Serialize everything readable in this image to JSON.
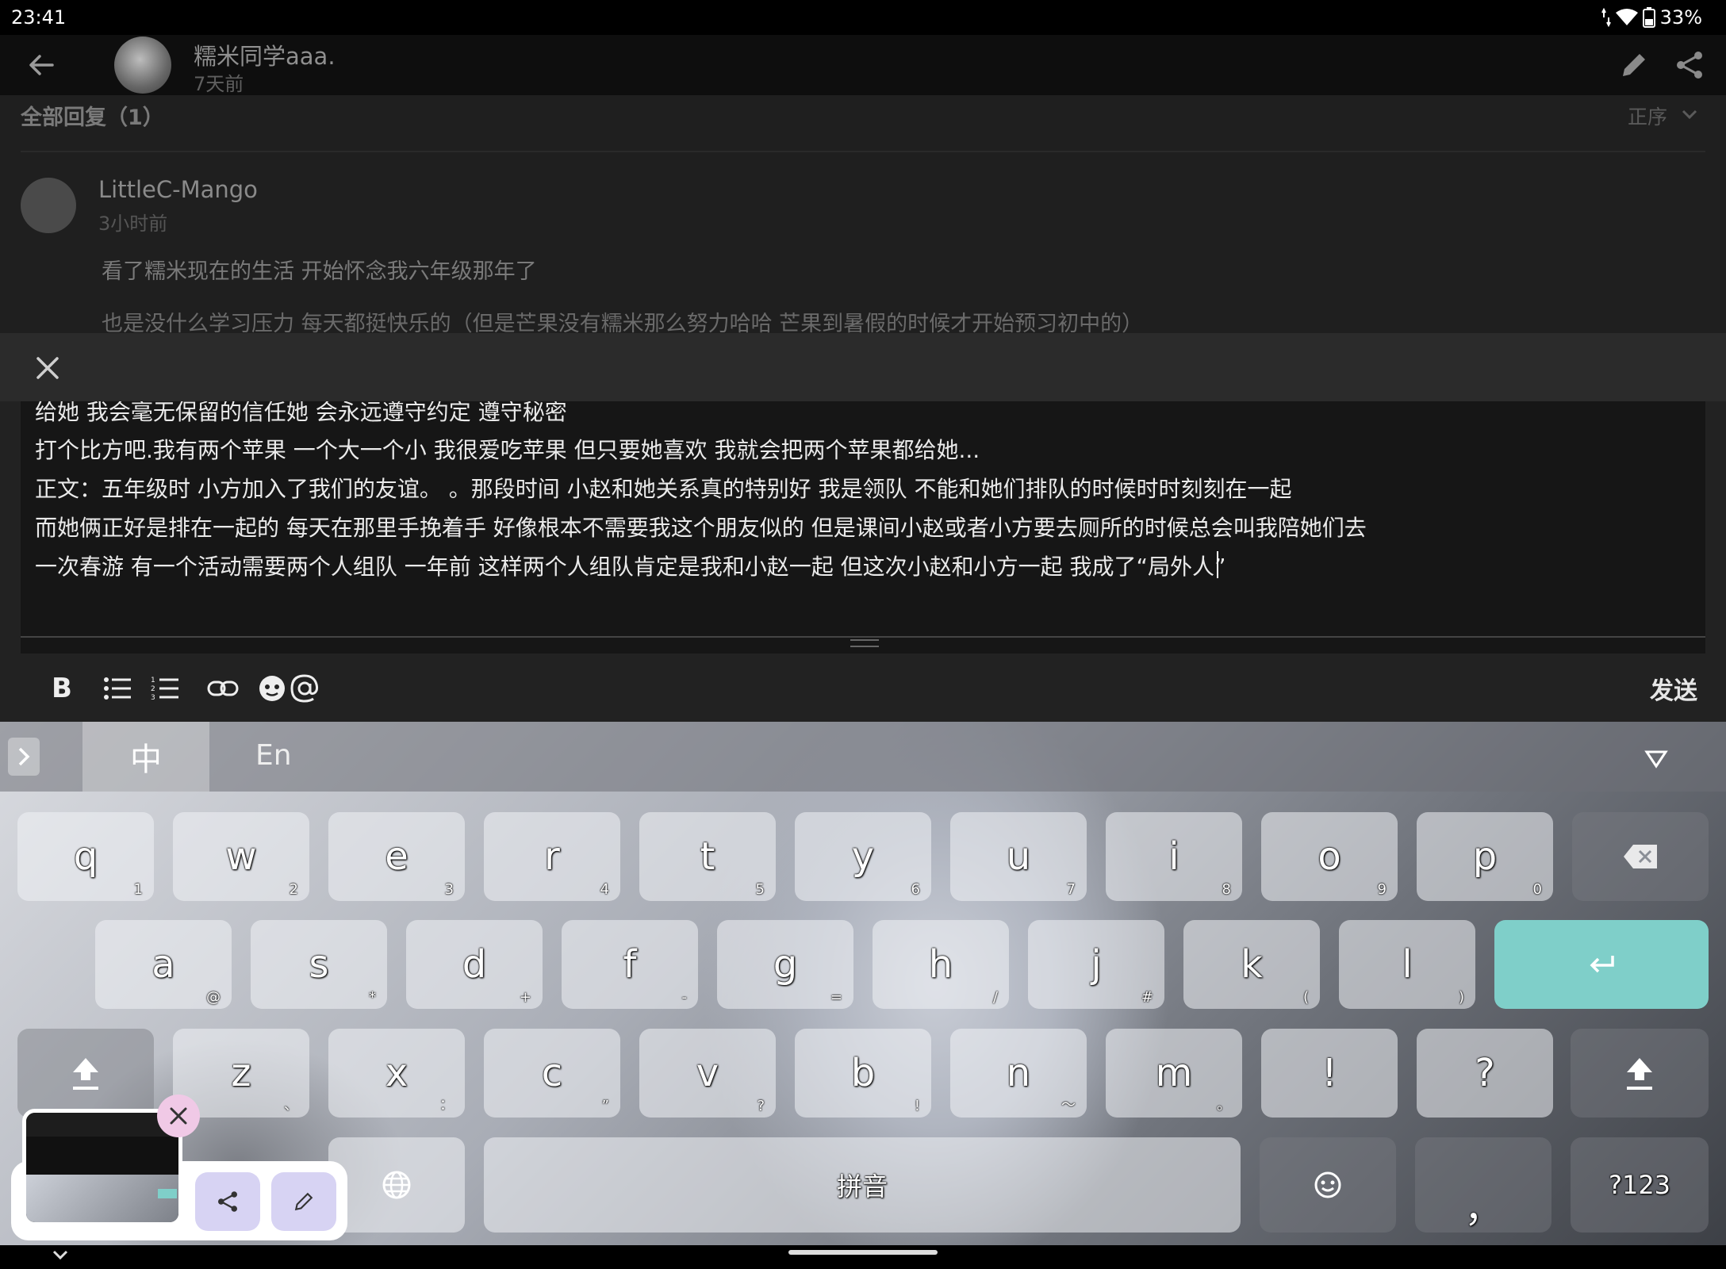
{
  "status_bar": {
    "time": "23:41",
    "battery": "33%"
  },
  "post": {
    "author": "糯米同学aaa.",
    "time": "7天前"
  },
  "comments": {
    "title": "全部回复（1）",
    "sort_label": "正序",
    "items": [
      {
        "author": "LittleC-Mango",
        "time": "3小时前",
        "lines": [
          "看了糯米现在的生活 开始怀念我六年级那年了",
          "也是没什么学习压力 每天都挺快乐的（但是芒果没有糯米那么努力哈哈 芒果到暑假的时候才开始预习初中的）"
        ]
      }
    ]
  },
  "editor": {
    "lines": [
      "给她 我会毫无保留的信任她 会永远遵守约定 遵守秘密",
      "打个比方吧.我有两个苹果 一个大一个小 我很爱吃苹果 但只要她喜欢 我就会把两个苹果都给她...",
      "正文：五年级时 小方加入了我们的友谊。 。那段时间 小赵和她关系真的特别好 我是领队 不能和她们排队的时候时时刻刻在一起",
      "而她俩正好是排在一起的 每天在那里手挽着手 好像根本不需要我这个朋友似的 但是课间小赵或者小方要去厕所的时候总会叫我陪她们去",
      "一次春游 有一个活动需要两个人组队 一年前 这样两个人组队肯定是我和小赵一起 但这次小赵和小方一起 我成了“局外人”"
    ],
    "send_label": "发送",
    "toolbar": {
      "bold": "B"
    }
  },
  "keyboard": {
    "lang_zh": "中",
    "lang_en": "En",
    "row1": [
      {
        "k": "q",
        "h": "1"
      },
      {
        "k": "w",
        "h": "2"
      },
      {
        "k": "e",
        "h": "3"
      },
      {
        "k": "r",
        "h": "4"
      },
      {
        "k": "t",
        "h": "5"
      },
      {
        "k": "y",
        "h": "6"
      },
      {
        "k": "u",
        "h": "7"
      },
      {
        "k": "i",
        "h": "8"
      },
      {
        "k": "o",
        "h": "9"
      },
      {
        "k": "p",
        "h": "0"
      }
    ],
    "row2": [
      {
        "k": "a",
        "h": "@"
      },
      {
        "k": "s",
        "h": "*"
      },
      {
        "k": "d",
        "h": "+"
      },
      {
        "k": "f",
        "h": "-"
      },
      {
        "k": "g",
        "h": "="
      },
      {
        "k": "h",
        "h": "/"
      },
      {
        "k": "j",
        "h": "#"
      },
      {
        "k": "k",
        "h": "("
      },
      {
        "k": "l",
        "h": ")"
      }
    ],
    "row3": [
      {
        "k": "z",
        "h": "、"
      },
      {
        "k": "x",
        "h": "："
      },
      {
        "k": "c",
        "h": "”"
      },
      {
        "k": "v",
        "h": "?"
      },
      {
        "k": "b",
        "h": "!"
      },
      {
        "k": "n",
        "h": "～"
      },
      {
        "k": "m",
        "h": "。"
      },
      {
        "k": "!",
        "h": ""
      },
      {
        "k": "?",
        "h": ""
      }
    ],
    "space_label": "拼音",
    "comma_label": "，",
    "symbols_label": "?123"
  },
  "colors": {
    "enter_key": "#7fcfc9",
    "screenshot_button": "#d7d3f3",
    "screenshot_close": "#f0c9e6"
  },
  "icons": [
    "back-arrow-icon",
    "edit-icon",
    "share-icon",
    "close-icon",
    "chevron-down-icon",
    "bold-icon",
    "bullet-list-icon",
    "numbered-list-icon",
    "link-icon",
    "emoji-icon",
    "mention-icon",
    "backspace-icon",
    "enter-icon",
    "shift-icon",
    "globe-icon",
    "smiley-icon",
    "wifi-icon",
    "battery-icon"
  ]
}
